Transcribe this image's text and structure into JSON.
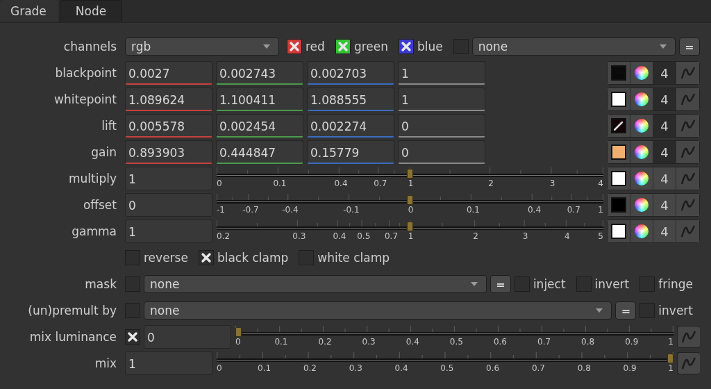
{
  "tabs": [
    {
      "label": "Grade",
      "selected": true
    },
    {
      "label": "Node",
      "selected": false
    }
  ],
  "rows": [
    {
      "kind": "channels",
      "label": "channels",
      "value": "rgb",
      "channels": [
        {
          "label": "red",
          "checked": true,
          "color": "#d23a3a"
        },
        {
          "label": "green",
          "checked": true,
          "color": "#35c435"
        },
        {
          "label": "blue",
          "checked": true,
          "color": "#3a3ad2"
        }
      ],
      "extra": {
        "checked": false,
        "value": "none"
      },
      "button": "="
    },
    {
      "kind": "color4",
      "label": "blackpoint",
      "fields": [
        {
          "value": "0.0027",
          "color": "#c84040"
        },
        {
          "value": "0.002743",
          "color": "#4c9a4c"
        },
        {
          "value": "0.002703",
          "color": "#3a6cc0"
        },
        {
          "value": "1",
          "color": "#8a8a8a"
        }
      ],
      "swatch": {
        "color": "#0a0a0a",
        "kind": "plain"
      },
      "count": "4",
      "split": true
    },
    {
      "kind": "color4",
      "label": "whitepoint",
      "fields": [
        {
          "value": "1.089624",
          "color": "#c84040"
        },
        {
          "value": "1.100411",
          "color": "#4c9a4c"
        },
        {
          "value": "1.088555",
          "color": "#3a6cc0"
        },
        {
          "value": "1",
          "color": "#8a8a8a"
        }
      ],
      "swatch": {
        "color": "#ffffff",
        "kind": "plain"
      },
      "count": "4",
      "split": true
    },
    {
      "kind": "color4",
      "label": "lift",
      "fields": [
        {
          "value": "0.005578",
          "color": "#c84040"
        },
        {
          "value": "0.002454",
          "color": "#4c9a4c"
        },
        {
          "value": "0.002274",
          "color": "#3a6cc0"
        },
        {
          "value": "0",
          "color": "#8a8a8a"
        }
      ],
      "swatch": {
        "color": "#140606",
        "kind": "picker"
      },
      "count": "4",
      "split": true
    },
    {
      "kind": "color4",
      "label": "gain",
      "fields": [
        {
          "value": "0.893903",
          "color": "#c84040"
        },
        {
          "value": "0.444847",
          "color": "#4c9a4c"
        },
        {
          "value": "0.15779",
          "color": "#3a6cc0"
        },
        {
          "value": "0",
          "color": "#8a8a8a"
        }
      ],
      "swatch": {
        "color": "#f0b070",
        "kind": "plain"
      },
      "count": "4",
      "split": true
    },
    {
      "kind": "slider",
      "label": "multiply",
      "value": "1",
      "level": 0.5,
      "ticks": [
        "0",
        "0.1",
        "0.4",
        "0.7",
        "1",
        "2",
        "3",
        "4"
      ],
      "swatch": {
        "color": "#ffffff",
        "kind": "plain"
      },
      "count": "4",
      "split": false
    },
    {
      "kind": "slider",
      "label": "offset",
      "value": "0",
      "level": 0.5,
      "ticks": [
        "-1",
        "-0.7",
        "-0.4",
        "-0.1",
        "0",
        "0.1",
        "0.4",
        "0.7",
        "1"
      ],
      "swatch": {
        "color": "#000000",
        "kind": "plain"
      },
      "count": "4",
      "split": false
    },
    {
      "kind": "slider",
      "label": "gamma",
      "value": "1",
      "level": 0.5,
      "ticks": [
        "0.2",
        "0.3",
        "0.4",
        "0.5",
        "0.7",
        "1",
        "2",
        "3",
        "4",
        "5"
      ],
      "swatch": {
        "color": "#ffffff",
        "kind": "plain"
      },
      "count": "4",
      "split": false
    },
    {
      "kind": "checks",
      "checks": [
        {
          "label": "reverse",
          "checked": false
        },
        {
          "label": "black clamp",
          "checked": true
        },
        {
          "label": "white clamp",
          "checked": false
        }
      ]
    },
    {
      "kind": "mask",
      "label": "mask",
      "checked": false,
      "value": "none",
      "button": "=",
      "checks": [
        {
          "label": "inject",
          "checked": false
        },
        {
          "label": "invert",
          "checked": false
        },
        {
          "label": "fringe",
          "checked": false
        }
      ]
    },
    {
      "kind": "mask",
      "label": "(un)premult by",
      "checked": false,
      "value": "none",
      "button": "=",
      "checks": [
        {
          "label": "invert",
          "checked": false
        }
      ]
    },
    {
      "kind": "mixslider",
      "label": "mix luminance",
      "checked": true,
      "value": "0",
      "level": 0,
      "ticks": [
        "0",
        "0.1",
        "0.2",
        "0.3",
        "0.4",
        "0.5",
        "0.6",
        "0.7",
        "0.8",
        "0.9",
        "1"
      ]
    },
    {
      "kind": "mixslider",
      "label": "mix",
      "value": "1",
      "level": 1,
      "ticks": [
        "0",
        "0.1",
        "0.2",
        "0.3",
        "0.4",
        "0.5",
        "0.6",
        "0.7",
        "0.8",
        "0.9",
        "1"
      ]
    }
  ]
}
